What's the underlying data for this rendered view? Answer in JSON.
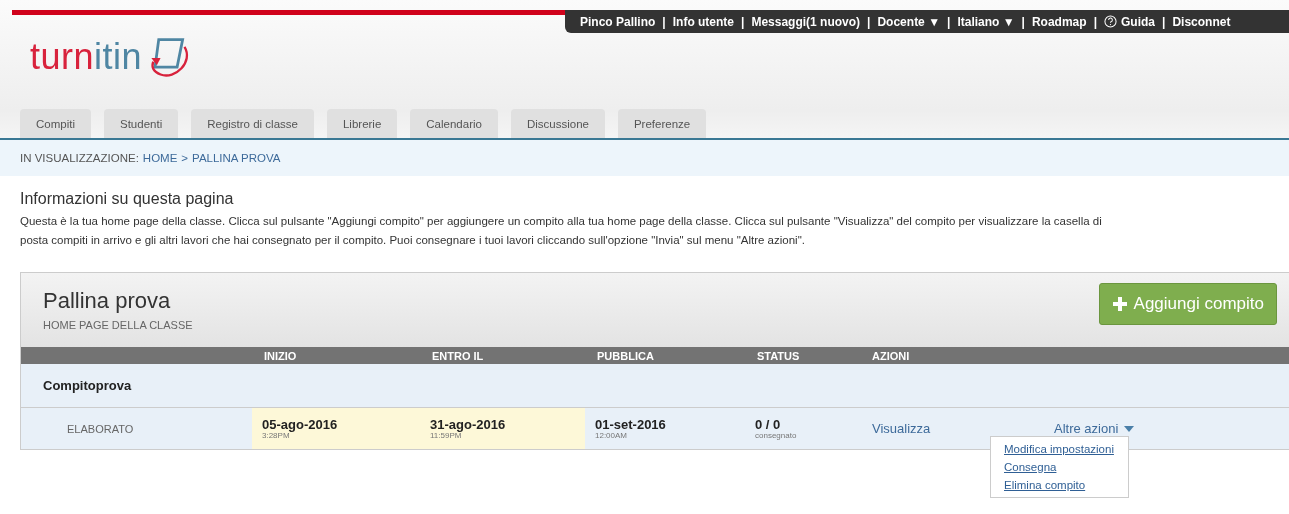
{
  "top_bar": {
    "separator": "|",
    "items": [
      {
        "label": "Pinco Pallino",
        "kind": "text"
      },
      {
        "label": "Info utente",
        "kind": "link"
      },
      {
        "label": "Messaggi(1 nuovo)",
        "kind": "link"
      },
      {
        "label": "Docente ▼",
        "kind": "menu"
      },
      {
        "label": "Italiano ▼",
        "kind": "menu"
      },
      {
        "label": "Roadmap",
        "kind": "link"
      },
      {
        "label": "Guida",
        "kind": "help"
      },
      {
        "label": "Disconnet",
        "kind": "link"
      }
    ]
  },
  "logo": {
    "parts": [
      {
        "text": "turn",
        "color": "#d8223c"
      },
      {
        "text": "itin",
        "color": "#4f86a3"
      }
    ]
  },
  "tabs": [
    {
      "label": "Compiti",
      "selected": false
    },
    {
      "label": "Studenti",
      "selected": false
    },
    {
      "label": "Registro di classe",
      "selected": false
    },
    {
      "label": "Librerie",
      "selected": false
    },
    {
      "label": "Calendario",
      "selected": false
    },
    {
      "label": "Discussione",
      "selected": false
    },
    {
      "label": "Preferenze",
      "selected": false
    }
  ],
  "breadcrumb": {
    "prefix": "IN VISUALIZZAZIONE:",
    "items": [
      "HOME",
      "PALLINA PROVA"
    ],
    "separator": ">"
  },
  "info": {
    "title": "Informazioni su questa pagina",
    "lines": [
      "Questa è la tua home page della classe. Clicca sul pulsante \"Aggiungi compito\" per aggiungere un compito alla tua home page della classe. Clicca sul pulsante \"Visualizza\" del compito per visualizzare la casella di",
      "posta compiti in arrivo e gli altri lavori che hai consegnato per il compito. Puoi consegnare i tuoi lavori cliccando sull'opzione \"Invia\" sul menu \"Altre azioni\"."
    ]
  },
  "class_panel": {
    "title": "Pallina prova",
    "subtitle": "HOME PAGE DELLA CLASSE",
    "add_button": "Aggiungi compito",
    "columns": [
      "INIZIO",
      "ENTRO IL",
      "PUBBLICA",
      "STATUS",
      "AZIONI"
    ],
    "group": "Compitoprova",
    "row": {
      "type": "ELABORATO",
      "dates": [
        {
          "date": "05-ago-2016",
          "time": "3:28PM",
          "highlighted": true
        },
        {
          "date": "31-ago-2016",
          "time": "11:59PM",
          "highlighted": true
        },
        {
          "date": "01-set-2016",
          "time": "12:00AM",
          "highlighted": false
        }
      ],
      "status": "0 / 0",
      "status_label": "consegnato",
      "view": "Visualizza",
      "more": "Altre azioni",
      "more_expanded": true,
      "menu": [
        "Modifica impostazioni",
        "Consegna",
        "Elimina compito"
      ]
    }
  }
}
